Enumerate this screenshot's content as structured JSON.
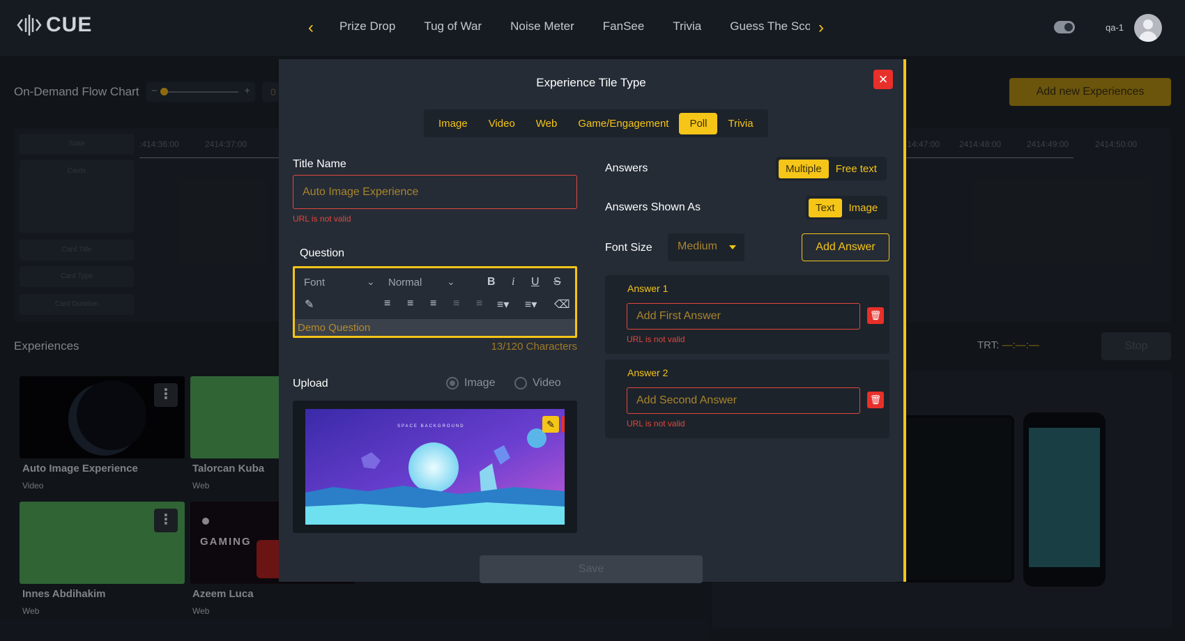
{
  "header": {
    "logo_text": "CUE",
    "nav_tabs": [
      "Prize Drop",
      "Tug of War",
      "Noise Meter",
      "FanSee",
      "Trivia",
      "Guess The Sco"
    ],
    "user_name": "qa-1"
  },
  "page": {
    "flow_chart_title": "On-Demand Flow Chart",
    "zoom_value": "0",
    "add_button": "Add new Experiences",
    "timeline_rows": [
      "State",
      "Cards",
      "Card Title",
      "Card Type",
      "Card Duration"
    ],
    "timeline_times": [
      ":414:36:00",
      "2414:37:00",
      "2414:47:00",
      "2414:48:00",
      "2414:49:00",
      "2414:50:00"
    ],
    "experiences_title": "Experiences",
    "trt_label": "TRT:",
    "trt_value": "—:—:—",
    "stop_button": "Stop",
    "cards": [
      {
        "title": "Auto Image Experience",
        "type": "Video"
      },
      {
        "title": "Talorcan Kuba",
        "type": "Web"
      },
      {
        "title": "Innes Abdihakim",
        "type": "Web"
      },
      {
        "title": "Azeem Luca",
        "type": "Web"
      }
    ]
  },
  "modal": {
    "title": "Experience Tile Type",
    "tabs": [
      "Image",
      "Video",
      "Web",
      "Game/Engagement",
      "Poll",
      "Trivia"
    ],
    "active_tab": "Poll",
    "title_name_label": "Title Name",
    "title_name_placeholder": "Auto Image Experience",
    "title_name_error": "URL is not valid",
    "question_label": "Question",
    "editor": {
      "font_placeholder": "Font",
      "size_value": "Normal",
      "text": "Demo Question",
      "char_count": "13/120 Characters"
    },
    "upload_label": "Upload",
    "upload_options": [
      "Image",
      "Video"
    ],
    "upload_selected": "Image",
    "save_button": "Save",
    "answers_label": "Answers",
    "answers_options": [
      "Multiple",
      "Free text"
    ],
    "answers_selected": "Multiple",
    "shown_as_label": "Answers Shown As",
    "shown_as_options": [
      "Text",
      "Image"
    ],
    "shown_as_selected": "Text",
    "font_size_label": "Font Size",
    "font_size_value": "Medium",
    "add_answer_button": "Add Answer",
    "answers": [
      {
        "label": "Answer 1",
        "placeholder": "Add First Answer",
        "error": "URL is not valid"
      },
      {
        "label": "Answer 2",
        "placeholder": "Add Second Answer",
        "error": "URL is not valid"
      }
    ],
    "upload_image_text": "SPACE BACKGROUND"
  },
  "colors": {
    "accent": "#f5c518",
    "danger": "#e8302a",
    "modal_bg": "#252c36",
    "page_bg": "#1b2129"
  }
}
